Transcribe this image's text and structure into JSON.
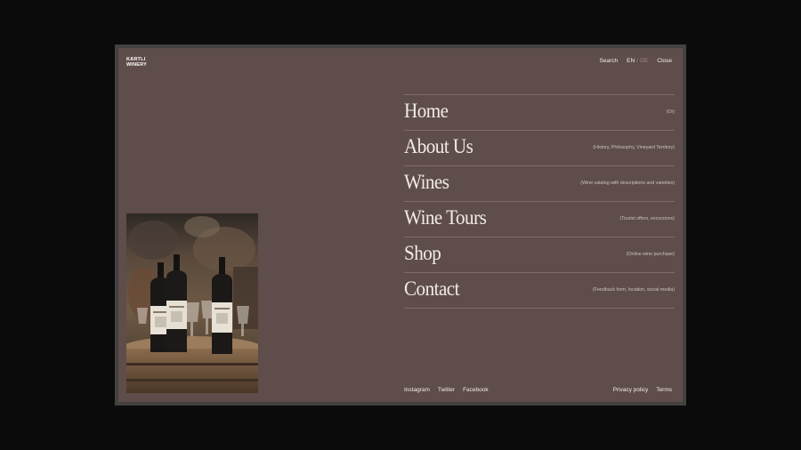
{
  "brand": {
    "line1": "KARTLI",
    "line2": "WINERY"
  },
  "topbar": {
    "search": "Search",
    "lang_en": "EN",
    "lang_sep": "/",
    "lang_ge": "GE",
    "close": "Close"
  },
  "menu": [
    {
      "label": "Home",
      "desc": "(Or)"
    },
    {
      "label": "About Us",
      "desc": "(History, Philosophy, Vineyard Territory)"
    },
    {
      "label": "Wines",
      "desc": "(Wine catalog with descriptions and varieties)"
    },
    {
      "label": "Wine Tours",
      "desc": "(Tourist offers, excursions)"
    },
    {
      "label": "Shop",
      "desc": "(Online wine purchase)"
    },
    {
      "label": "Contact",
      "desc": "(Feedback form, location, social media)"
    }
  ],
  "footer": {
    "instagram": "Instagram",
    "twitter": "Twitter",
    "facebook": "Facebook",
    "privacy": "Privacy policy",
    "terms": "Terms"
  },
  "colors": {
    "panel_bg": "#5e4d4a",
    "frame": "#444241",
    "text": "#f3ebe6",
    "divider": "#7d6c68"
  }
}
